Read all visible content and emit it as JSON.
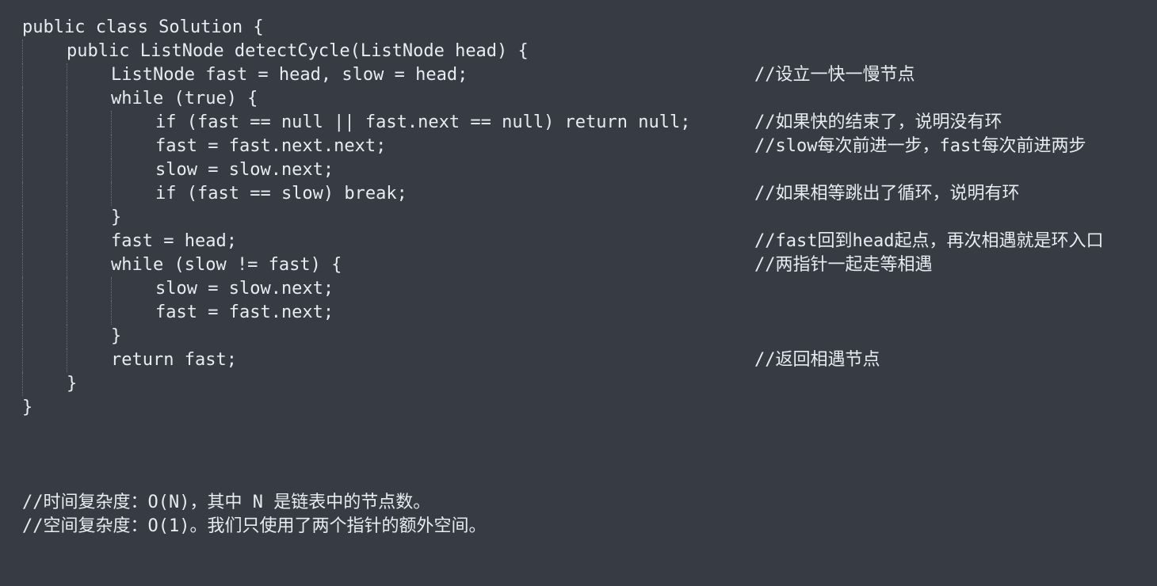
{
  "code": {
    "lines": [
      {
        "text": "public class Solution {",
        "comment": ""
      },
      {
        "text": "public ListNode detectCycle(ListNode head) {",
        "comment": ""
      },
      {
        "text": "ListNode fast = head, slow = head;",
        "comment": "//设立一快一慢节点"
      },
      {
        "text": "while (true) {",
        "comment": ""
      },
      {
        "text": "if (fast == null || fast.next == null) return null;",
        "comment": "//如果快的结束了，说明没有环"
      },
      {
        "text": "fast = fast.next.next;",
        "comment": "//slow每次前进一步，fast每次前进两步"
      },
      {
        "text": "slow = slow.next;",
        "comment": ""
      },
      {
        "text": "if (fast == slow) break;",
        "comment": "//如果相等跳出了循环，说明有环"
      },
      {
        "text": "}",
        "comment": ""
      },
      {
        "text": "fast = head;",
        "comment": "//fast回到head起点，再次相遇就是环入口"
      },
      {
        "text": "while (slow != fast) {",
        "comment": "//两指针一起走等相遇"
      },
      {
        "text": "slow = slow.next;",
        "comment": ""
      },
      {
        "text": "fast = fast.next;",
        "comment": ""
      },
      {
        "text": "}",
        "comment": ""
      },
      {
        "text": "return fast;",
        "comment": "//返回相遇节点"
      },
      {
        "text": "}",
        "comment": ""
      },
      {
        "text": "}",
        "comment": ""
      }
    ],
    "complexity": {
      "time": "//时间复杂度：O(N)，其中 N 是链表中的节点数。",
      "space": "//空间复杂度：O(1)。我们只使用了两个指针的额外空间。"
    }
  },
  "colors": {
    "background": "#363b44",
    "text": "#e8ebf0",
    "indent_guide": "#6b717c"
  }
}
